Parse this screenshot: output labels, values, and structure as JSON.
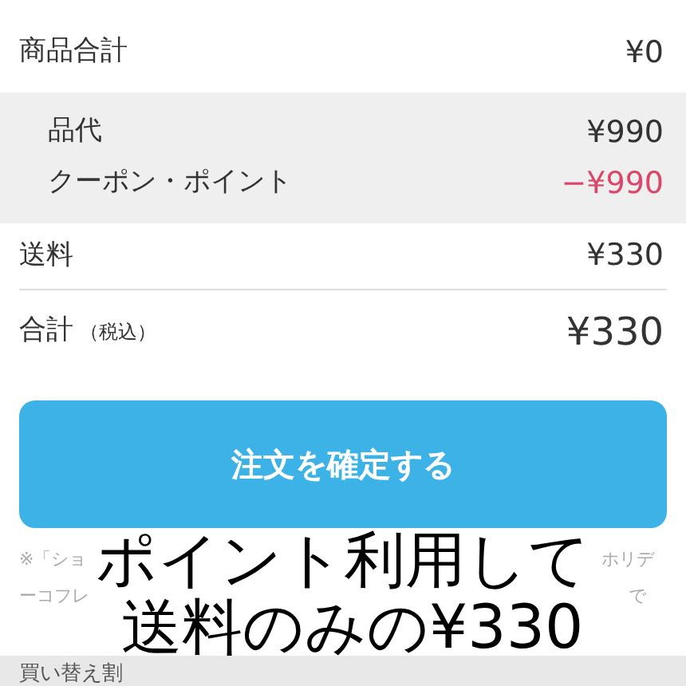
{
  "summary": {
    "label": "商品合計",
    "value": "¥0"
  },
  "breakdown": [
    {
      "label": "品代",
      "value": "¥990",
      "kind": "normal"
    },
    {
      "label": "クーポン・ポイント",
      "value": "−¥990",
      "kind": "discount"
    }
  ],
  "shipping": {
    "label": "送料",
    "value": "¥330"
  },
  "total": {
    "label": "合計",
    "sub": "（税込）",
    "value": "¥330"
  },
  "confirm_button": "注文を確定する",
  "note_lines": [
    [
      "※「ショ",
      "ホリデ"
    ],
    [
      "ーコフレ",
      "で"
    ]
  ],
  "handwriting": [
    "ポイント利用して",
    "送料のみの¥330"
  ],
  "next_section": "買い替え割"
}
